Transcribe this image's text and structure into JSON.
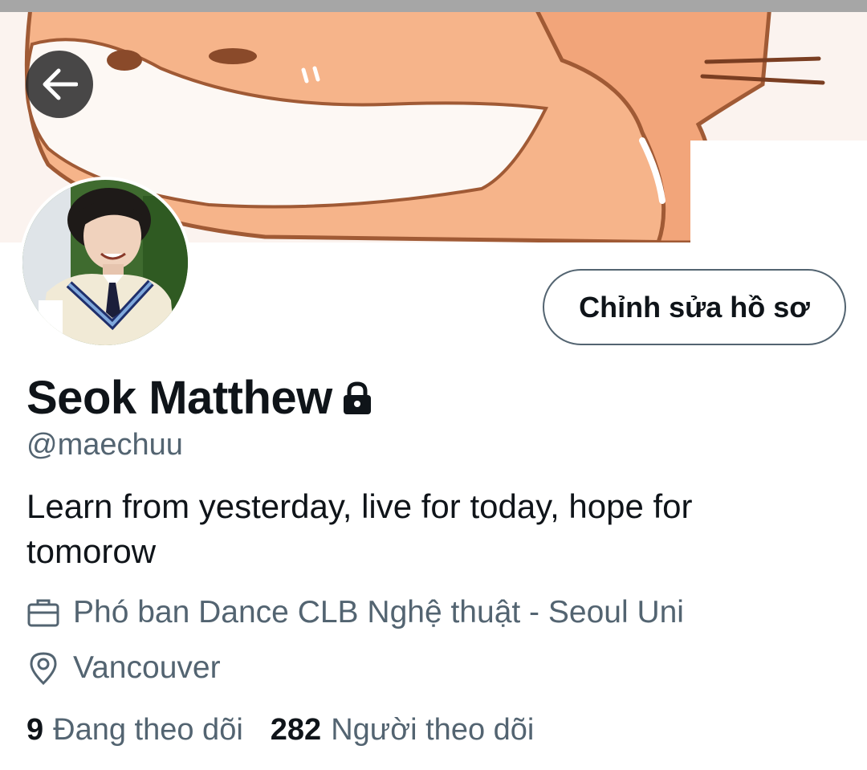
{
  "profile": {
    "display_name": "Seok Matthew",
    "handle": "@maechuu",
    "bio": "Learn from yesterday, live for today, hope for tomorow",
    "job": "Phó ban Dance CLB Nghệ thuật - Seoul Uni",
    "location": "Vancouver",
    "protected": true
  },
  "actions": {
    "edit_profile_label": "Chỉnh sửa hồ sơ"
  },
  "stats": {
    "following_count": "9",
    "following_label": "Đang theo dõi",
    "followers_count": "282",
    "followers_label": "Người theo dõi"
  },
  "icons": {
    "back": "arrow-left-icon",
    "lock": "lock-icon",
    "job": "briefcase-icon",
    "location": "location-pin-icon"
  },
  "colors": {
    "primary_text": "#0f1419",
    "secondary_text": "#536471",
    "banner_orange": "#f4a878",
    "border": "#536471"
  }
}
